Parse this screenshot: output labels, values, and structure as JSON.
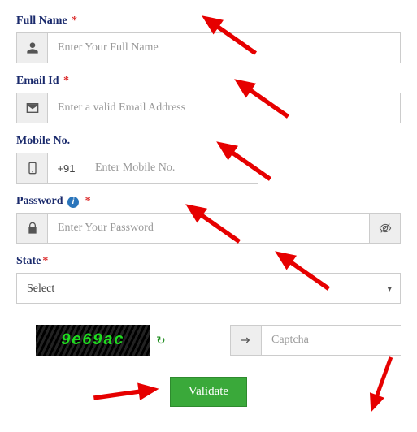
{
  "fields": {
    "fullname": {
      "label": "Full Name",
      "placeholder": "Enter Your Full Name",
      "required": true
    },
    "email": {
      "label": "Email Id",
      "placeholder": "Enter a valid Email Address",
      "required": true
    },
    "mobile": {
      "label": "Mobile No.",
      "placeholder": "Enter Mobile No.",
      "country_code": "+91"
    },
    "password": {
      "label": "Password",
      "placeholder": "Enter Your Password",
      "required": true
    },
    "state": {
      "label": "State",
      "placeholder": "Select",
      "required": true
    },
    "captcha": {
      "placeholder": "Captcha",
      "image_text": "9e69ac"
    }
  },
  "buttons": {
    "validate": "Validate"
  }
}
